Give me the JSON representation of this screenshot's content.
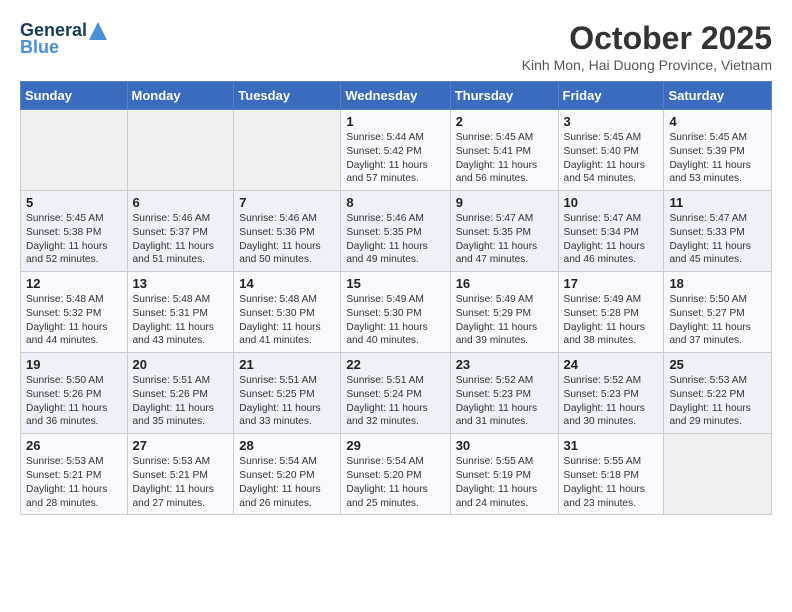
{
  "header": {
    "logo_line1": "General",
    "logo_line2": "Blue",
    "month_title": "October 2025",
    "subtitle": "Kinh Mon, Hai Duong Province, Vietnam"
  },
  "weekdays": [
    "Sunday",
    "Monday",
    "Tuesday",
    "Wednesday",
    "Thursday",
    "Friday",
    "Saturday"
  ],
  "weeks": [
    [
      {
        "day": "",
        "text": ""
      },
      {
        "day": "",
        "text": ""
      },
      {
        "day": "",
        "text": ""
      },
      {
        "day": "1",
        "text": "Sunrise: 5:44 AM\nSunset: 5:42 PM\nDaylight: 11 hours and 57 minutes."
      },
      {
        "day": "2",
        "text": "Sunrise: 5:45 AM\nSunset: 5:41 PM\nDaylight: 11 hours and 56 minutes."
      },
      {
        "day": "3",
        "text": "Sunrise: 5:45 AM\nSunset: 5:40 PM\nDaylight: 11 hours and 54 minutes."
      },
      {
        "day": "4",
        "text": "Sunrise: 5:45 AM\nSunset: 5:39 PM\nDaylight: 11 hours and 53 minutes."
      }
    ],
    [
      {
        "day": "5",
        "text": "Sunrise: 5:45 AM\nSunset: 5:38 PM\nDaylight: 11 hours and 52 minutes."
      },
      {
        "day": "6",
        "text": "Sunrise: 5:46 AM\nSunset: 5:37 PM\nDaylight: 11 hours and 51 minutes."
      },
      {
        "day": "7",
        "text": "Sunrise: 5:46 AM\nSunset: 5:36 PM\nDaylight: 11 hours and 50 minutes."
      },
      {
        "day": "8",
        "text": "Sunrise: 5:46 AM\nSunset: 5:35 PM\nDaylight: 11 hours and 49 minutes."
      },
      {
        "day": "9",
        "text": "Sunrise: 5:47 AM\nSunset: 5:35 PM\nDaylight: 11 hours and 47 minutes."
      },
      {
        "day": "10",
        "text": "Sunrise: 5:47 AM\nSunset: 5:34 PM\nDaylight: 11 hours and 46 minutes."
      },
      {
        "day": "11",
        "text": "Sunrise: 5:47 AM\nSunset: 5:33 PM\nDaylight: 11 hours and 45 minutes."
      }
    ],
    [
      {
        "day": "12",
        "text": "Sunrise: 5:48 AM\nSunset: 5:32 PM\nDaylight: 11 hours and 44 minutes."
      },
      {
        "day": "13",
        "text": "Sunrise: 5:48 AM\nSunset: 5:31 PM\nDaylight: 11 hours and 43 minutes."
      },
      {
        "day": "14",
        "text": "Sunrise: 5:48 AM\nSunset: 5:30 PM\nDaylight: 11 hours and 41 minutes."
      },
      {
        "day": "15",
        "text": "Sunrise: 5:49 AM\nSunset: 5:30 PM\nDaylight: 11 hours and 40 minutes."
      },
      {
        "day": "16",
        "text": "Sunrise: 5:49 AM\nSunset: 5:29 PM\nDaylight: 11 hours and 39 minutes."
      },
      {
        "day": "17",
        "text": "Sunrise: 5:49 AM\nSunset: 5:28 PM\nDaylight: 11 hours and 38 minutes."
      },
      {
        "day": "18",
        "text": "Sunrise: 5:50 AM\nSunset: 5:27 PM\nDaylight: 11 hours and 37 minutes."
      }
    ],
    [
      {
        "day": "19",
        "text": "Sunrise: 5:50 AM\nSunset: 5:26 PM\nDaylight: 11 hours and 36 minutes."
      },
      {
        "day": "20",
        "text": "Sunrise: 5:51 AM\nSunset: 5:26 PM\nDaylight: 11 hours and 35 minutes."
      },
      {
        "day": "21",
        "text": "Sunrise: 5:51 AM\nSunset: 5:25 PM\nDaylight: 11 hours and 33 minutes."
      },
      {
        "day": "22",
        "text": "Sunrise: 5:51 AM\nSunset: 5:24 PM\nDaylight: 11 hours and 32 minutes."
      },
      {
        "day": "23",
        "text": "Sunrise: 5:52 AM\nSunset: 5:23 PM\nDaylight: 11 hours and 31 minutes."
      },
      {
        "day": "24",
        "text": "Sunrise: 5:52 AM\nSunset: 5:23 PM\nDaylight: 11 hours and 30 minutes."
      },
      {
        "day": "25",
        "text": "Sunrise: 5:53 AM\nSunset: 5:22 PM\nDaylight: 11 hours and 29 minutes."
      }
    ],
    [
      {
        "day": "26",
        "text": "Sunrise: 5:53 AM\nSunset: 5:21 PM\nDaylight: 11 hours and 28 minutes."
      },
      {
        "day": "27",
        "text": "Sunrise: 5:53 AM\nSunset: 5:21 PM\nDaylight: 11 hours and 27 minutes."
      },
      {
        "day": "28",
        "text": "Sunrise: 5:54 AM\nSunset: 5:20 PM\nDaylight: 11 hours and 26 minutes."
      },
      {
        "day": "29",
        "text": "Sunrise: 5:54 AM\nSunset: 5:20 PM\nDaylight: 11 hours and 25 minutes."
      },
      {
        "day": "30",
        "text": "Sunrise: 5:55 AM\nSunset: 5:19 PM\nDaylight: 11 hours and 24 minutes."
      },
      {
        "day": "31",
        "text": "Sunrise: 5:55 AM\nSunset: 5:18 PM\nDaylight: 11 hours and 23 minutes."
      },
      {
        "day": "",
        "text": ""
      }
    ]
  ]
}
